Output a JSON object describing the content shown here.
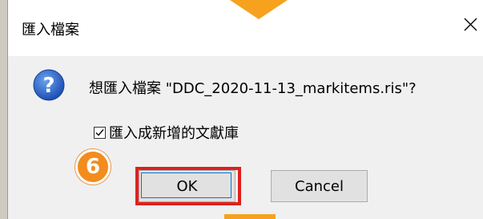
{
  "dialog": {
    "title": "匯入檔案",
    "message": "想匯入檔案 \"DDC_2020-11-13_markitems.ris\"?",
    "checkbox": {
      "label": "匯入成新增的文獻庫",
      "checked": true
    },
    "buttons": {
      "ok_label": "OK",
      "cancel_label": "Cancel"
    },
    "icons": {
      "question": "question-icon",
      "close": "close-icon"
    }
  },
  "annotation": {
    "step_number": "6",
    "colors": {
      "badge": "#f28c1e",
      "highlight": "#e0201c",
      "arrow": "#f6a21e"
    }
  }
}
